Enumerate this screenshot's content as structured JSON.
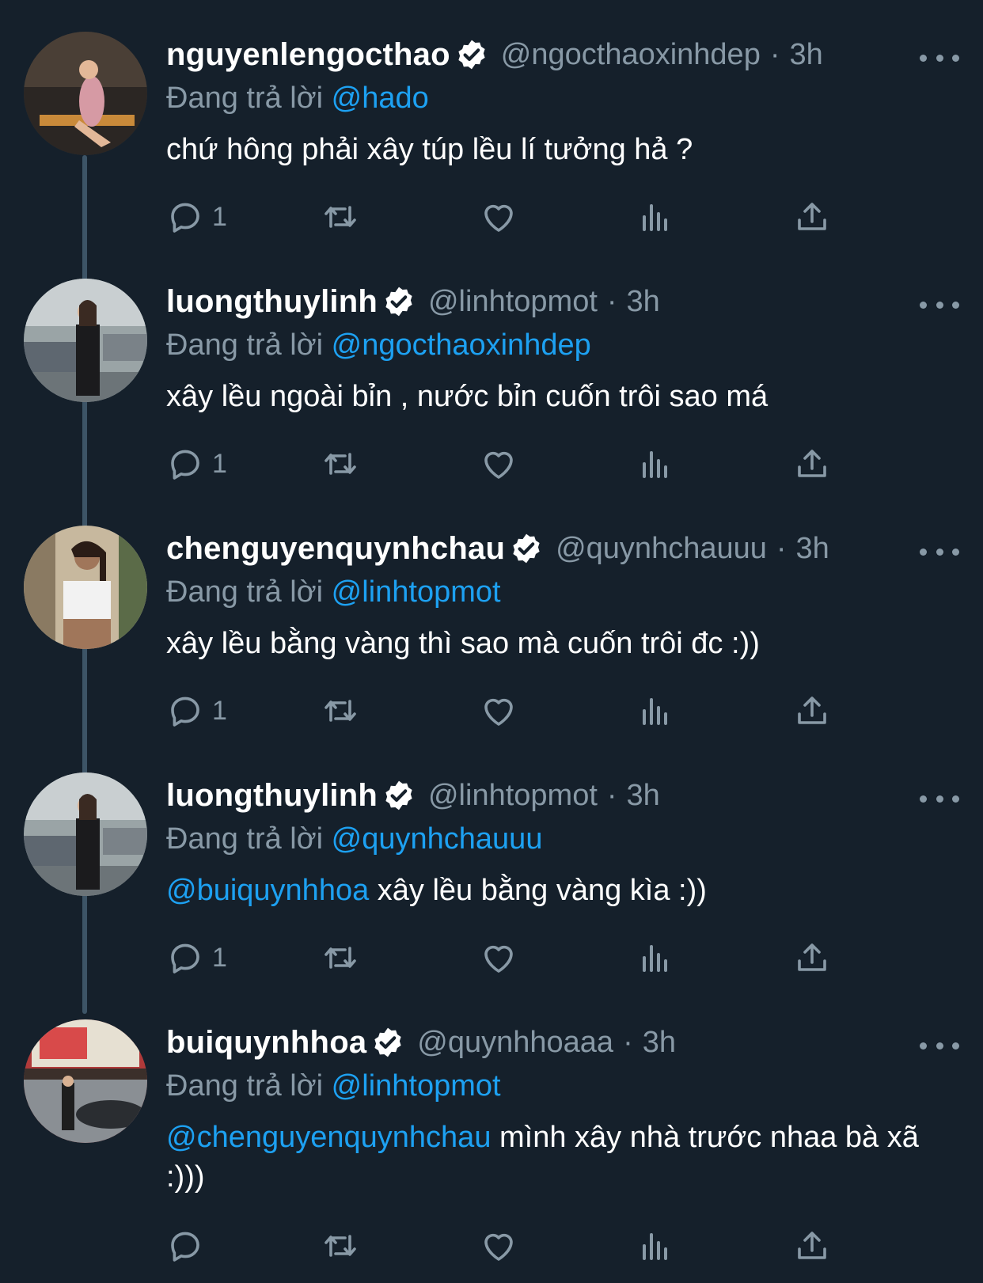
{
  "reply_prefix": "Đang trả lời",
  "colors": {
    "background": "#15202b",
    "muted": "#8899a6",
    "link": "#1da1f2",
    "text": "#ffffff"
  },
  "tweets": [
    {
      "name": "nguyenlengocthao",
      "handle": "@ngocthaoxinhdep",
      "dot": "·",
      "time": "3h",
      "reply_to": "@hado",
      "text_mention": "",
      "text": "chứ hông phải xây túp lều lí tưởng hả ?",
      "reply_count": "1",
      "icons": [
        "reply-icon",
        "retweet-icon",
        "like-icon",
        "analytics-icon",
        "share-icon"
      ]
    },
    {
      "name": "luongthuylinh",
      "handle": "@linhtopmot",
      "dot": "·",
      "time": "3h",
      "reply_to": "@ngocthaoxinhdep",
      "text_mention": "",
      "text": "xây lều ngoài bỉn , nước bỉn cuốn trôi sao má",
      "reply_count": "1",
      "icons": [
        "reply-icon",
        "retweet-icon",
        "like-icon",
        "analytics-icon",
        "share-icon"
      ]
    },
    {
      "name": "chenguyenquynhchau",
      "handle": "@quynhchauuu",
      "dot": "·",
      "time": "3h",
      "reply_to": "@linhtopmot",
      "text_mention": "",
      "text": "xây lều bằng vàng thì sao mà cuốn trôi đc :))",
      "reply_count": "1",
      "icons": [
        "reply-icon",
        "retweet-icon",
        "like-icon",
        "analytics-icon",
        "share-icon"
      ]
    },
    {
      "name": "luongthuylinh",
      "handle": "@linhtopmot",
      "dot": "·",
      "time": "3h",
      "reply_to": "@quynhchauuu",
      "text_mention": "@buiquynhhoa",
      "text": " xây lều bằng vàng kìa :))",
      "reply_count": "1",
      "icons": [
        "reply-icon",
        "retweet-icon",
        "like-icon",
        "analytics-icon",
        "share-icon"
      ]
    },
    {
      "name": "buiquynhhoa",
      "handle": "@quynhhoaaa",
      "dot": "·",
      "time": "3h",
      "reply_to": "@linhtopmot",
      "text_mention": "@chenguyenquynhchau",
      "text": " mình xây nhà trước nhaa bà xã :)))",
      "reply_count": "",
      "icons": [
        "reply-icon",
        "retweet-icon",
        "like-icon",
        "analytics-icon",
        "share-icon"
      ]
    }
  ]
}
